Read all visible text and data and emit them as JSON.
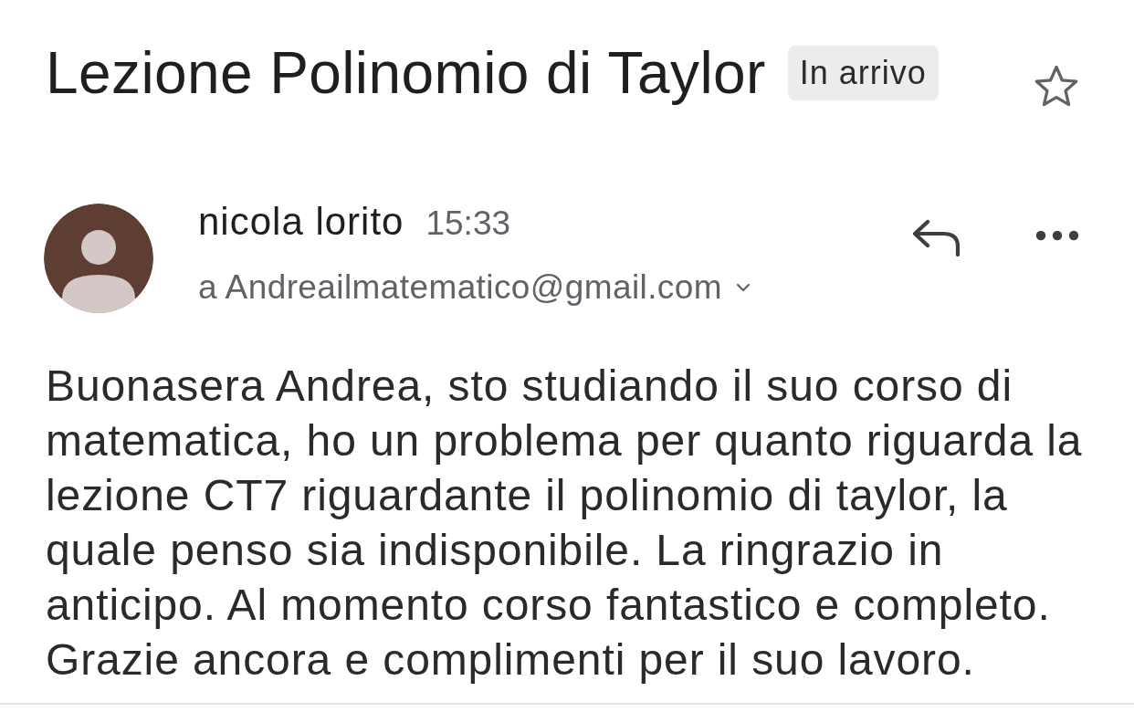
{
  "subject": "Lezione Polinomio di Taylor",
  "label": "In arrivo",
  "starred": false,
  "message": {
    "sender": "nicola lorito",
    "time": "15:33",
    "recipient": "a Andreailmatematico@gmail.com",
    "body": "Buonasera Andrea, sto studiando il suo corso di matematica, ho un problema per quanto riguarda la lezione CT7 riguardante il polinomio di taylor, la quale penso sia indisponibile. La ringrazio in anticipo. Al momento corso fantastico e completo. Grazie ancora e complimenti per il suo lavoro."
  }
}
